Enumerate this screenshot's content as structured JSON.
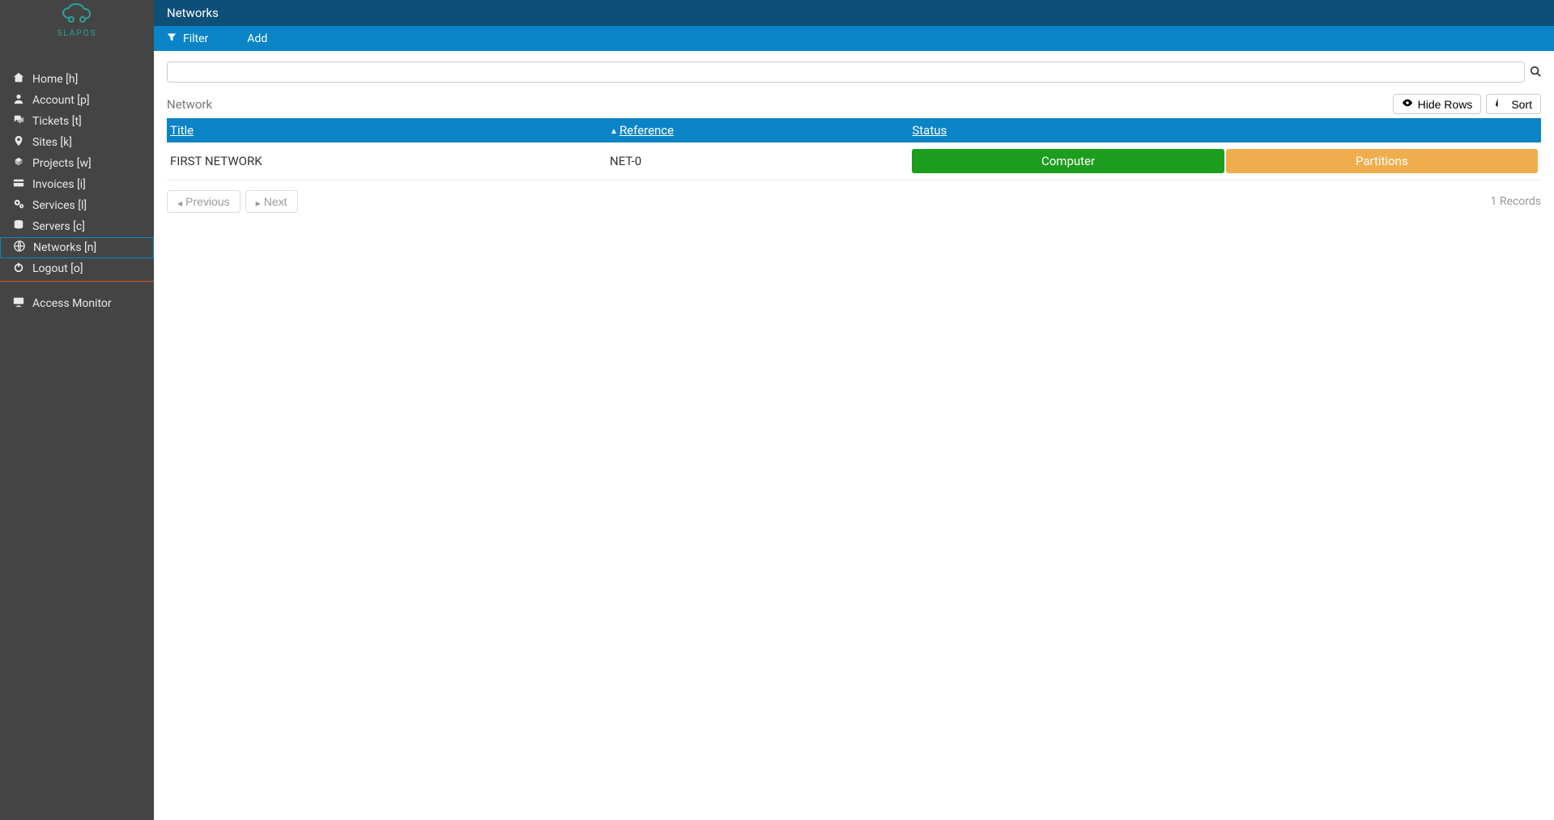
{
  "logo": {
    "text": "SLAPOS"
  },
  "sidebar": {
    "items": [
      {
        "label": "Home [h]",
        "icon": "home"
      },
      {
        "label": "Account [p]",
        "icon": "user"
      },
      {
        "label": "Tickets [t]",
        "icon": "comments"
      },
      {
        "label": "Sites [k]",
        "icon": "map-pin"
      },
      {
        "label": "Projects [w]",
        "icon": "cubes"
      },
      {
        "label": "Invoices [i]",
        "icon": "credit-card"
      },
      {
        "label": "Services [l]",
        "icon": "cogs"
      },
      {
        "label": "Servers [c]",
        "icon": "database"
      },
      {
        "label": "Networks [n]",
        "icon": "globe",
        "active": true
      },
      {
        "label": "Logout [o]",
        "icon": "power"
      }
    ],
    "divider_after_index": 9,
    "extra": {
      "label": "Access Monitor",
      "icon": "desktop"
    }
  },
  "header": {
    "title": "Networks"
  },
  "actions": {
    "filter": "Filter",
    "add": "Add"
  },
  "search": {
    "value": ""
  },
  "listing": {
    "caption": "Network",
    "hide_rows": "Hide Rows",
    "sort": "Sort",
    "columns": {
      "title": "Title",
      "reference": "Reference",
      "status": "Status"
    },
    "sort_column": "reference",
    "rows": [
      {
        "title": "FIRST NETWORK",
        "reference": "NET-0",
        "status": [
          {
            "text": "Computer",
            "class": "badge-green"
          },
          {
            "text": "Partitions",
            "class": "badge-orange"
          }
        ]
      }
    ]
  },
  "pager": {
    "previous": "Previous",
    "next": "Next",
    "records": "1 Records"
  }
}
